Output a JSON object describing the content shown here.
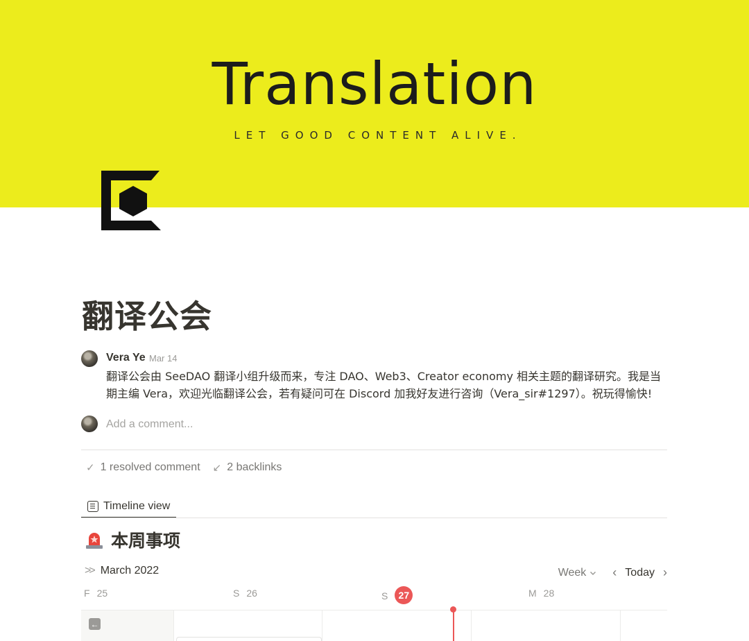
{
  "cover": {
    "title": "Translation",
    "tagline": "LET GOOD CONTENT ALIVE.",
    "background_color": "#ecec1c"
  },
  "page_icon": {
    "name": "seedao-logo-icon"
  },
  "page": {
    "title": "翻译公会"
  },
  "comment": {
    "author": "Vera Ye",
    "date": "Mar 14",
    "body": "翻译公会由 SeeDAO 翻译小组升级而来，专注 DAO、Web3、Creator economy 相关主题的翻译研究。我是当期主编 Vera，欢迎光临翻译公会，若有疑问可在 Discord 加我好友进行咨询（Vera_sir#1297）。祝玩得愉快!"
  },
  "add_comment": {
    "placeholder": "Add a comment..."
  },
  "meta": {
    "resolved": "1 resolved comment",
    "backlinks": "2 backlinks"
  },
  "view_tab": {
    "label": "Timeline view"
  },
  "database": {
    "title": "本周事项",
    "icon": "siren-icon"
  },
  "timeline": {
    "month": "March 2022",
    "scale": "Week",
    "today_label": "Today",
    "days": [
      {
        "dow": "F",
        "num": "25",
        "current": false
      },
      {
        "dow": "S",
        "num": "26",
        "current": false
      },
      {
        "dow": "S",
        "num": "27",
        "current": true
      },
      {
        "dow": "M",
        "num": "28",
        "current": false
      }
    ],
    "accent_color": "#eb5757"
  }
}
